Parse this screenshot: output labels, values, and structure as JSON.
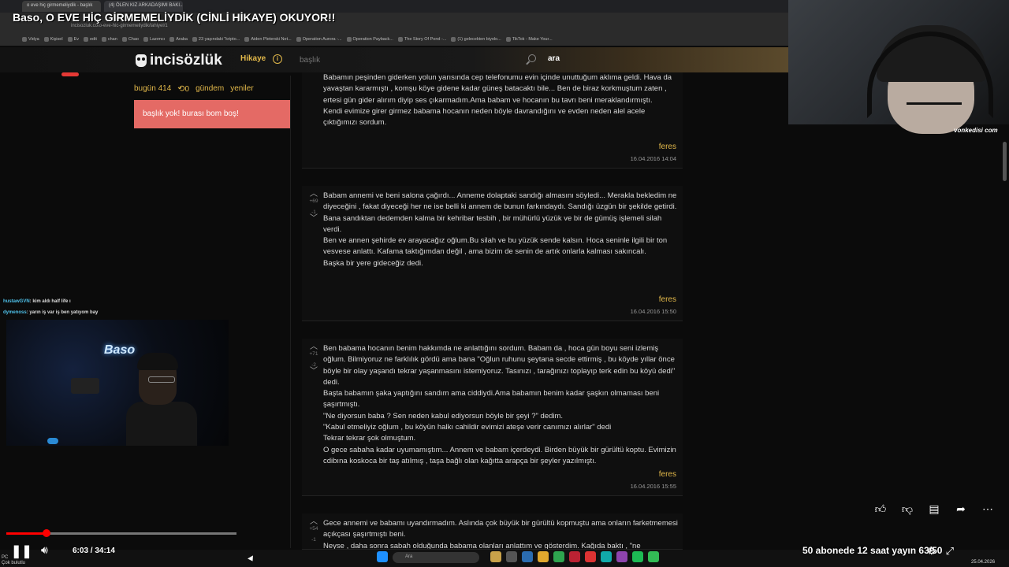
{
  "video": {
    "title": "Baso, O EVE HİÇ GİRMEMELİYDİK (CİNLİ HİKAYE) OKUYOR!!",
    "time": "6:03 / 34:14",
    "progress_fraction": 0.176,
    "bottom_text": "50 abonede 12 saat yayın 63/50",
    "watermark": "vonkedisi com"
  },
  "browser": {
    "tabs": [
      "o eve hiç girmemeliydik - başlık",
      "(4) ÖLEN KIZ ARKADAŞIMI BAKI..."
    ],
    "url": "incisozluk.co/o-eve-hic-girmemeliydik/lahiyel/1",
    "bookmarks": [
      "Vidya",
      "Kişisel",
      "Ev",
      "edit",
      "chan",
      "Chao",
      "Lazımcı",
      "Araba",
      "23 yaşındaki \"kripto...",
      "Aiden Pleterski Net...",
      "Operation Aurora -...",
      "Operation Payback...",
      "The Story Of Pond -...",
      "(1) gelecekten biyolo...",
      "TikTok - Make Your..."
    ]
  },
  "site": {
    "logo": "incisözlük",
    "nav_hikaye": "Hikaye",
    "search_placeholder": "başlık",
    "search_button": "ara",
    "left_nav": {
      "today": "bugün 414",
      "refresh_count": "0",
      "gundem": "gündem",
      "yeniler": "yeniler"
    },
    "alert": "başlık yok! burası bom boş!"
  },
  "entries": [
    {
      "paragraphs": [
        "Babamın peşinden giderken yolun yarısında cep telefonumu evin içinde unuttuğum aklıma geldi. Hava da yavaştan kararmıştı , komşu köye gidene kadar güneş batacaktı bile... Ben de biraz korkmuştum zaten , ertesi gün gider alırım diyip ses çıkarmadım.Ama babam ve hocanın bu tavrı beni meraklandırmıştı.",
        "Kendi evimize girer girmez babama hocanın neden böyle davrandığını ve evden neden alel acele çıktığımızı sordum."
      ],
      "author": "feres",
      "date": "16.04.2016 14:04"
    },
    {
      "up": "+69",
      "down": "-1",
      "paragraphs": [
        "Babam annemi ve beni salona çağırdı... Anneme dolaptaki sandığı almasını söyledi... Merakla bekledim ne diyeceğini , fakat diyeceği her ne ise belli ki annem de bunun farkındaydı. Sandığı üzgün bir şekilde getirdi.",
        "Bana sandıktan dedemden kalma bir kehribar tesbih , bir mühürlü yüzük ve bir de gümüş işlemeli silah verdi.",
        "Ben ve annen şehirde ev arayacağız oğlum.Bu silah ve bu yüzük sende kalsın. Hoca seninle ilgili bir ton vesvese anlattı. Kafama taktığımdan değil , ama bizim de senin de artık onlarla kalması sakıncalı.",
        "Başka bir yere gideceğiz dedi."
      ],
      "author": "feres",
      "date": "16.04.2016 15:50"
    },
    {
      "up": "+71",
      "down": "-2",
      "paragraphs": [
        "Ben babama hocanın benim hakkımda ne anlattığını sordum. Babam da , hoca gün boyu seni izlemiş oğlum. Bilmiyoruz ne farklılık gördü ama bana \"Oğlun ruhunu şeytana secde ettirmiş , bu köyde yıllar önce böyle bir olay yaşandı tekrar yaşanmasını istemiyoruz. Tasınızı , tarağınızı toplayıp terk edin bu köyü dedi\" dedi.",
        "Başta babamın şaka yaptığını sandım ama ciddiydi.Ama babamın benim kadar şaşkın olmaması beni şaşırtmıştı.",
        "\"Ne diyorsun baba ? Sen neden kabul ediyorsun böyle bir şeyi ?\" dedim.",
        "\"Kabul etmeliyiz oğlum , bu köyün halkı cahildir evimizi ateşe verir canımızı alırlar\" dedi",
        "Tekrar tekrar şok olmuştum.",
        "O gece sabaha kadar uyumamıştım... Annem ve babam içerdeydi. Birden büyük bir gürültü koptu. Evimizin cdibına koskoca bir taş atılmış , taşa bağlı olan kağıtta arapça bir şeyler yazılmıştı."
      ],
      "author": "feres",
      "date": "16.04.2016 15:55"
    },
    {
      "up": "+54",
      "down": "-1",
      "paragraphs": [
        "Gece annemi ve babamı uyandırmadım. Aslında çok büyük bir gürültü kopmuştu ama onların farketmemesi açıkçası şaşırtmıştı beni.",
        "Neyse , daha sonra sabah olduğunda babama olanları anlattım ve gösterdim. Kağıda baktı , \"ne"
      ]
    }
  ],
  "chat": [
    {
      "user": "hustawGVN",
      "message": ": kim aldı half life ı"
    },
    {
      "user": "dymenoss",
      "message": ": yarın iş var iş ben yatıyom bay"
    }
  ],
  "webcam": {
    "neon_sign": "Baso"
  },
  "taskbar": {
    "search": "Ara",
    "left_status": "PC\nÇok bulutlu",
    "clock": "\n25.04.2026"
  },
  "icons": {
    "like": "thumbs-up-icon",
    "dislike": "thumbs-down-icon",
    "comment": "comment-icon",
    "share": "share-icon",
    "more": "more-icon"
  }
}
